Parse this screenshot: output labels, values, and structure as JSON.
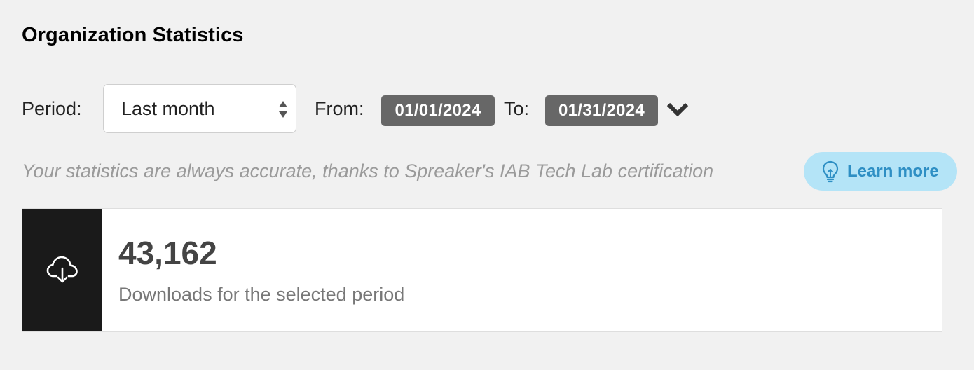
{
  "header": {
    "title": "Organization Statistics"
  },
  "filters": {
    "period_label": "Period:",
    "period_value": "Last month",
    "from_label": "From:",
    "from_date": "01/01/2024",
    "to_label": "To:",
    "to_date": "01/31/2024",
    "toggle_icon": "chevron-down-icon"
  },
  "notice": {
    "text": "Your statistics are always accurate, thanks to Spreaker's IAB Tech Lab certification",
    "button_label": "Learn more",
    "button_icon": "lightbulb-icon"
  },
  "stat": {
    "icon": "cloud-download-icon",
    "value": "43,162",
    "caption": "Downloads for the selected period"
  },
  "colors": {
    "background": "#f1f1f1",
    "chip": "#676767",
    "learn_bg": "#b4e4f7",
    "learn_text": "#2e8fc4",
    "icon_box": "#1a1a1a"
  }
}
